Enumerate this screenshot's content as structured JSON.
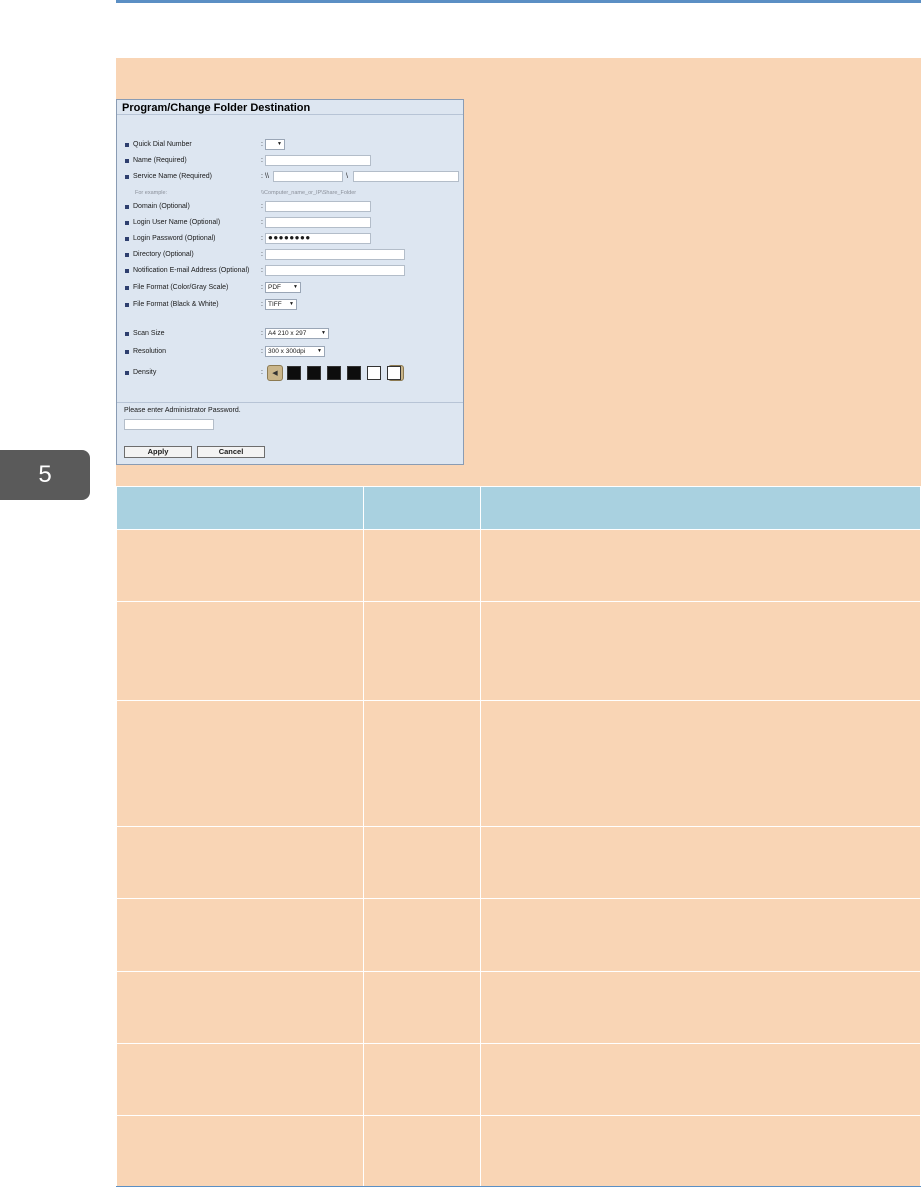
{
  "chapter": "5",
  "form": {
    "title": "Program/Change Folder Destination",
    "fields": [
      {
        "label": "Quick Dial Number"
      },
      {
        "label": "Name (Required)"
      },
      {
        "label": "Service Name (Required)",
        "prefix": "\\\\",
        "sep": "\\"
      },
      {
        "hint_label": "For example:",
        "hint_value": "\\\\Computer_name_or_IP\\Share_Folder"
      },
      {
        "label": "Domain (Optional)"
      },
      {
        "label": "Login User Name (Optional)"
      },
      {
        "label": "Login Password (Optional)",
        "value": "●●●●●●●●"
      },
      {
        "label": "Directory (Optional)"
      },
      {
        "label": "Notification E-mail Address (Optional)"
      },
      {
        "label": "File Format (Color/Gray Scale)",
        "value": "PDF"
      },
      {
        "label": "File Format (Black & White)",
        "value": "TIFF"
      },
      {
        "label": "Scan Size",
        "value": "A4 210 x 297"
      },
      {
        "label": "Resolution",
        "value": "300 x 300dpi"
      },
      {
        "label": "Density",
        "level": 4,
        "max": 7
      }
    ],
    "admin_prompt": "Please enter Administrator Password.",
    "apply_label": "Apply",
    "cancel_label": "Cancel"
  },
  "colors": {
    "panel": "#f9d5b5",
    "table_header": "#a9d1e0",
    "accent": "#5b8fc4"
  }
}
